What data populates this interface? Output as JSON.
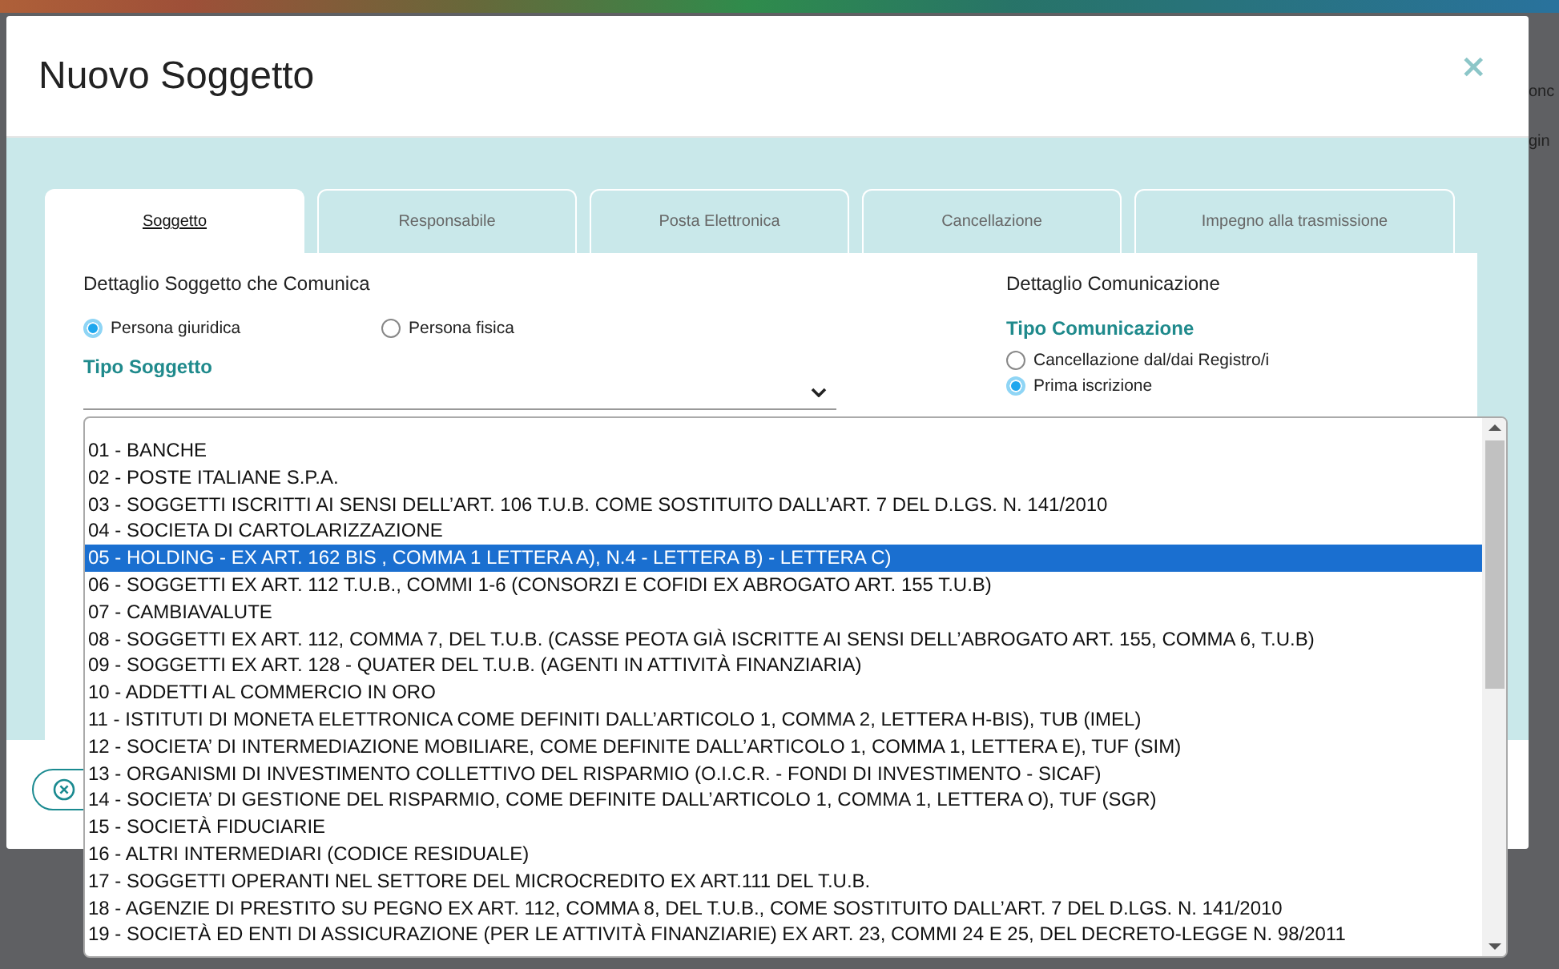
{
  "page_behind": [
    {
      "text": "onc"
    },
    {
      "text": "gin"
    }
  ],
  "dialog": {
    "title": "Nuovo Soggetto",
    "close": "×"
  },
  "tabs": [
    {
      "label": "Soggetto",
      "selected": true
    },
    {
      "label": "Responsabile",
      "selected": false
    },
    {
      "label": "Posta Elettronica",
      "selected": false
    },
    {
      "label": "Cancellazione",
      "selected": false
    },
    {
      "label": "Impegno alla trasmissione",
      "selected": false
    }
  ],
  "left_section": {
    "heading": "Dettaglio Soggetto che Comunica",
    "radios": [
      {
        "label": "Persona giuridica",
        "selected": true
      },
      {
        "label": "Persona fisica",
        "selected": false
      }
    ],
    "field_label": "Tipo Soggetto"
  },
  "right_section": {
    "heading": "Dettaglio Comunicazione",
    "field_label": "Tipo Comunicazione",
    "radios": [
      {
        "label": "Cancellazione dal/dai Registro/i",
        "selected": false
      },
      {
        "label": "Prima iscrizione",
        "selected": true
      }
    ]
  },
  "dropdown": {
    "options": [
      {
        "label": "01 - BANCHE",
        "selected": false
      },
      {
        "label": "02 - POSTE ITALIANE S.P.A.",
        "selected": false
      },
      {
        "label": "03 - SOGGETTI ISCRITTI AI SENSI DELL’ART. 106 T.U.B. COME SOSTITUITO DALL’ART. 7 DEL D.LGS. N. 141/2010",
        "selected": false
      },
      {
        "label": "04 - SOCIETA DI CARTOLARIZZAZIONE",
        "selected": false
      },
      {
        "label": "05 - HOLDING - EX ART. 162 BIS , COMMA 1 LETTERA A), N.4 - LETTERA B) - LETTERA C)",
        "selected": true
      },
      {
        "label": "06 - SOGGETTI EX ART. 112 T.U.B., COMMI 1-6 (CONSORZI E COFIDI EX ABROGATO ART. 155 T.U.B)",
        "selected": false
      },
      {
        "label": "07 - CAMBIAVALUTE",
        "selected": false
      },
      {
        "label": "08 - SOGGETTI EX ART. 112, COMMA 7, DEL T.U.B. (CASSE PEOTA GIÀ ISCRITTE AI SENSI DELL’ABROGATO ART. 155, COMMA 6, T.U.B)",
        "selected": false
      },
      {
        "label": "09 - SOGGETTI EX ART. 128 - QUATER DEL T.U.B. (AGENTI IN ATTIVITÀ FINANZIARIA)",
        "selected": false
      },
      {
        "label": "10 - ADDETTI AL COMMERCIO IN ORO",
        "selected": false
      },
      {
        "label": "11 - ISTITUTI DI MONETA ELETTRONICA COME DEFINITI DALL’ARTICOLO 1, COMMA 2, LETTERA H-BIS), TUB (IMEL)",
        "selected": false
      },
      {
        "label": "12 - SOCIETA’ DI INTERMEDIAZIONE MOBILIARE, COME DEFINITE DALL’ARTICOLO 1, COMMA 1, LETTERA E), TUF (SIM)",
        "selected": false
      },
      {
        "label": "13 - ORGANISMI DI INVESTIMENTO COLLETTIVO DEL RISPARMIO (O.I.C.R. - FONDI DI INVESTIMENTO - SICAF)",
        "selected": false
      },
      {
        "label": "14 - SOCIETA’ DI GESTIONE DEL RISPARMIO, COME DEFINITE DALL’ARTICOLO 1, COMMA 1, LETTERA O), TUF (SGR)",
        "selected": false
      },
      {
        "label": "15 - SOCIETÀ FIDUCIARIE",
        "selected": false
      },
      {
        "label": "16 - ALTRI INTERMEDIARI (CODICE RESIDUALE)",
        "selected": false
      },
      {
        "label": "17 - SOGGETTI OPERANTI NEL SETTORE DEL MICROCREDITO EX ART.111 DEL T.U.B.",
        "selected": false
      },
      {
        "label": "18 - AGENZIE DI PRESTITO SU PEGNO EX ART. 112, COMMA 8, DEL T.U.B., COME SOSTITUITO DALL’ART. 7 DEL D.LGS. N. 141/2010",
        "selected": false
      },
      {
        "label": "19 - SOCIETÀ ED ENTI DI ASSICURAZIONE (PER LE ATTIVITÀ FINANZIARIE) EX ART. 23, COMMI 24 E 25, DEL DECRETO-LEGGE N. 98/2011",
        "selected": false
      }
    ]
  }
}
